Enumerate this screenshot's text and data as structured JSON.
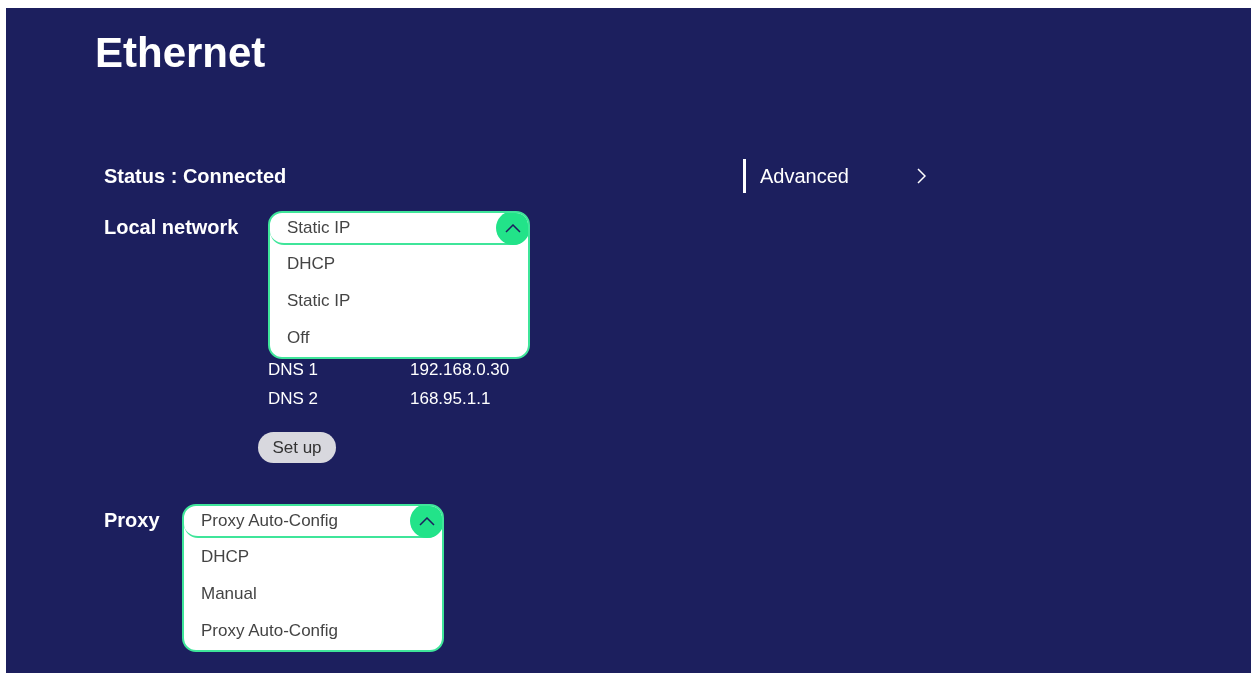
{
  "title": "Ethernet",
  "status": "Status : Connected",
  "advanced": {
    "label": "Advanced"
  },
  "local_network": {
    "label": "Local network",
    "dropdown": {
      "value": "Static IP",
      "expanded": true,
      "options": [
        "DHCP",
        "Static IP",
        "Off"
      ]
    },
    "details": [
      {
        "label": "DNS 1",
        "value": "192.168.0.30"
      },
      {
        "label": "DNS 2",
        "value": "168.95.1.1"
      }
    ],
    "setup_button": "Set up"
  },
  "proxy": {
    "label": "Proxy",
    "dropdown": {
      "value": "Proxy Auto-Config",
      "expanded": true,
      "options": [
        "DHCP",
        "Manual",
        "Proxy Auto-Config"
      ]
    }
  }
}
